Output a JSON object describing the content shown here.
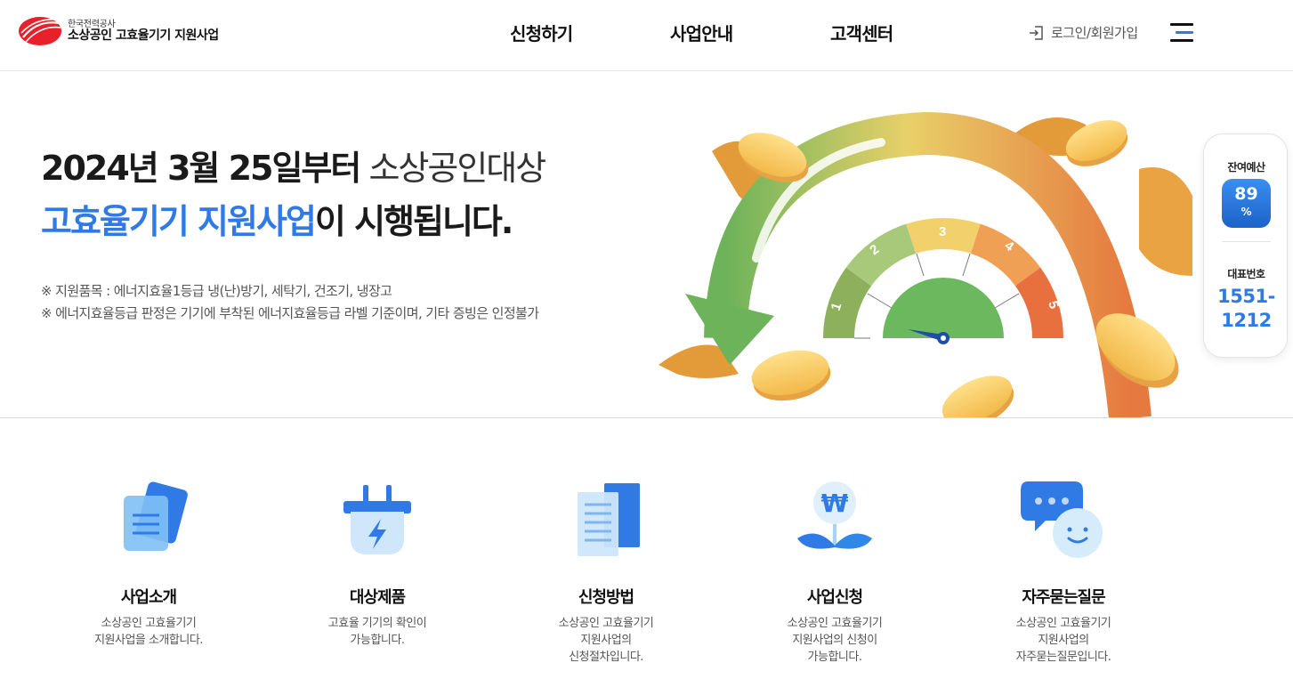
{
  "header": {
    "org": "한국전력공사",
    "service": "소상공인 고효율기기 지원사업",
    "nav": [
      "신청하기",
      "사업안내",
      "고객센터"
    ],
    "login": "로그인/회원가입"
  },
  "hero": {
    "line1_strong": "2024년 3월 25일부터",
    "line1_light": "소상공인대상",
    "line2_blue": "고효율기기 지원사업",
    "line2_rest": "이 시행됩니다.",
    "notes": [
      "※ 지원품목 : 에너지효율1등급 냉(난)방기, 세탁기, 건조기, 냉장고",
      "※ 에너지효율등급 판정은 기기에 부착된 에너지효율등급 라벨 기준이며, 기타 증빙은 인정불가"
    ],
    "gauge_levels": [
      "1",
      "2",
      "3",
      "4",
      "5"
    ]
  },
  "side": {
    "budget_label": "잔여예산",
    "budget_value": "89",
    "budget_unit": "%",
    "phone_label": "대표번호",
    "phone_line1": "1551-",
    "phone_line2": "1212"
  },
  "quick_menu": [
    {
      "title": "사업소개",
      "desc": [
        "소상공인 고효율기기",
        "지원사업을 소개합니다."
      ],
      "icon": "document-cards-icon"
    },
    {
      "title": "대상제품",
      "desc": [
        "고효율 기기의 확인이",
        "가능합니다."
      ],
      "icon": "power-plug-icon"
    },
    {
      "title": "신청방법",
      "desc": [
        "소상공인 고효율기기",
        "지원사업의",
        "신청절차입니다."
      ],
      "icon": "document-list-icon"
    },
    {
      "title": "사업신청",
      "desc": [
        "소상공인 고효율기기",
        "지원사업의 신청이",
        "가능합니다."
      ],
      "icon": "won-sprout-icon"
    },
    {
      "title": "자주묻는질문",
      "desc": [
        "소상공인 고효율기기",
        "지원사업의",
        "자주묻는질문입니다."
      ],
      "icon": "chat-bubble-icon"
    }
  ],
  "colors": {
    "accent_blue": "#2f7ae5",
    "gauge_1": "#8cb05c",
    "gauge_2": "#a9c97a",
    "gauge_3": "#f2d06b",
    "gauge_4": "#f0a055",
    "gauge_5": "#e8703f",
    "gauge_center": "#6cb85e"
  }
}
